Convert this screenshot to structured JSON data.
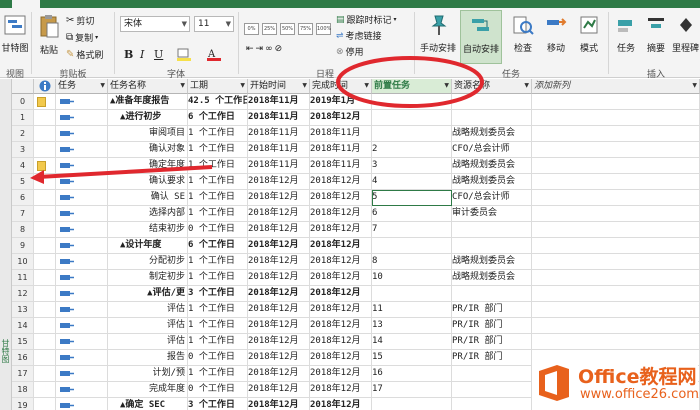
{
  "ribbon": {
    "view_group": {
      "gantt_label": "甘特图",
      "label": "视图"
    },
    "clipboard": {
      "paste": "粘贴",
      "cut": "剪切",
      "copy": "复制",
      "format_painter": "格式刷",
      "label": "剪贴板"
    },
    "font": {
      "family": "宋体",
      "size": "11",
      "label": "字体"
    },
    "schedule": {
      "track_mark": "跟踪时标记",
      "respect_links": "考虑链接",
      "deactivate": "停用",
      "label": "日程",
      "percent": [
        "0%",
        "25%",
        "50%",
        "75%",
        "100%"
      ]
    },
    "tasks": {
      "manual": "手动安排",
      "auto": "自动安排",
      "inspect": "检查",
      "move": "移动",
      "mode": "模式",
      "label": "任务"
    },
    "insert": {
      "task": "任务",
      "summary": "摘要",
      "milestone": "里程碑",
      "label": "插入"
    }
  },
  "sidebar": {
    "label": "甘特图"
  },
  "grid": {
    "headers": {
      "info": "",
      "mode": "任务",
      "name": "任务名称",
      "duration": "工期",
      "start": "开始时间",
      "finish": "完成时间",
      "predecessors": "前置任务",
      "resources": "资源名称",
      "add": "添加新列"
    },
    "rows": [
      {
        "id": "0",
        "note": true,
        "name": "▲准备年度报告",
        "duration": "42.5 个工作日",
        "start": "2018年11月",
        "finish": "2019年1月",
        "pred": "",
        "res": "",
        "bold": true,
        "indent": 0
      },
      {
        "id": "1",
        "note": false,
        "name": "▲进行初步",
        "duration": "6 个工作日",
        "start": "2018年11月",
        "finish": "2018年12月",
        "pred": "",
        "res": "",
        "bold": true,
        "indent": 1
      },
      {
        "id": "2",
        "note": false,
        "name": "审阅项目",
        "duration": "1 个工作日",
        "start": "2018年11月",
        "finish": "2018年11月",
        "pred": "",
        "res": "战略规划委员会",
        "bold": false,
        "indent": 2
      },
      {
        "id": "3",
        "note": false,
        "name": "确认对象",
        "duration": "1 个工作日",
        "start": "2018年11月",
        "finish": "2018年11月",
        "pred": "2",
        "res": "CFO/总会计师",
        "bold": false,
        "indent": 2
      },
      {
        "id": "4",
        "note": true,
        "name": "确定年度",
        "duration": "1 个工作日",
        "start": "2018年11月",
        "finish": "2018年11月",
        "pred": "3",
        "res": "战略规划委员会",
        "bold": false,
        "indent": 2
      },
      {
        "id": "5",
        "note": false,
        "name": "确认要求",
        "duration": "1 个工作日",
        "start": "2018年12月",
        "finish": "2018年12月",
        "pred": "4",
        "res": "战略规划委员会",
        "bold": false,
        "indent": 2
      },
      {
        "id": "6",
        "note": false,
        "name": "确认 SE",
        "duration": "1 个工作日",
        "start": "2018年12月",
        "finish": "2018年12月",
        "pred": "5",
        "res": "CFO/总会计师",
        "bold": false,
        "indent": 2
      },
      {
        "id": "7",
        "note": false,
        "name": "选择内部",
        "duration": "1 个工作日",
        "start": "2018年12月",
        "finish": "2018年12月",
        "pred": "6",
        "res": "审计委员会",
        "bold": false,
        "indent": 2
      },
      {
        "id": "8",
        "note": false,
        "name": "结束初步",
        "duration": "0 个工作日",
        "start": "2018年12月",
        "finish": "2018年12月",
        "pred": "7",
        "res": "",
        "bold": false,
        "indent": 2
      },
      {
        "id": "9",
        "note": false,
        "name": "▲设计年度",
        "duration": "6 个工作日",
        "start": "2018年12月",
        "finish": "2018年12月",
        "pred": "",
        "res": "",
        "bold": true,
        "indent": 1
      },
      {
        "id": "10",
        "note": false,
        "name": "分配初步",
        "duration": "1 个工作日",
        "start": "2018年12月",
        "finish": "2018年12月",
        "pred": "8",
        "res": "战略规划委员会",
        "bold": false,
        "indent": 2
      },
      {
        "id": "11",
        "note": false,
        "name": "制定初步",
        "duration": "1 个工作日",
        "start": "2018年12月",
        "finish": "2018年12月",
        "pred": "10",
        "res": "战略规划委员会",
        "bold": false,
        "indent": 2
      },
      {
        "id": "12",
        "note": false,
        "name": "▲评估/更",
        "duration": "3 个工作日",
        "start": "2018年12月",
        "finish": "2018年12月",
        "pred": "",
        "res": "",
        "bold": true,
        "indent": 2
      },
      {
        "id": "13",
        "note": false,
        "name": "评估",
        "duration": "1 个工作日",
        "start": "2018年12月",
        "finish": "2018年12月",
        "pred": "11",
        "res": "PR/IR 部门",
        "bold": false,
        "indent": 3
      },
      {
        "id": "14",
        "note": false,
        "name": "评估",
        "duration": "1 个工作日",
        "start": "2018年12月",
        "finish": "2018年12月",
        "pred": "13",
        "res": "PR/IR 部门",
        "bold": false,
        "indent": 3
      },
      {
        "id": "15",
        "note": false,
        "name": "评估",
        "duration": "1 个工作日",
        "start": "2018年12月",
        "finish": "2018年12月",
        "pred": "14",
        "res": "PR/IR 部门",
        "bold": false,
        "indent": 3
      },
      {
        "id": "16",
        "note": false,
        "name": "报告",
        "duration": "0 个工作日",
        "start": "2018年12月",
        "finish": "2018年12月",
        "pred": "15",
        "res": "PR/IR 部门",
        "bold": false,
        "indent": 3
      },
      {
        "id": "17",
        "note": false,
        "name": "计划/预",
        "duration": "1 个工作日",
        "start": "2018年12月",
        "finish": "2018年12月",
        "pred": "16",
        "res": "",
        "bold": false,
        "indent": 2
      },
      {
        "id": "18",
        "note": false,
        "name": "完成年度",
        "duration": "0 个工作日",
        "start": "2018年12月",
        "finish": "2018年12月",
        "pred": "17",
        "res": "",
        "bold": false,
        "indent": 2
      },
      {
        "id": "19",
        "note": false,
        "name": "▲确定 SEC",
        "duration": "3 个工作日",
        "start": "2018年12月",
        "finish": "2018年12月",
        "pred": "",
        "res": "",
        "bold": true,
        "indent": 1
      }
    ],
    "selected_row": "6"
  },
  "watermark": {
    "brand": "Office教程网",
    "domain": "www.office26.com"
  },
  "colors": {
    "accent": "#2e7a46",
    "annotation": "#e0282e",
    "logo": "#e8611c"
  }
}
